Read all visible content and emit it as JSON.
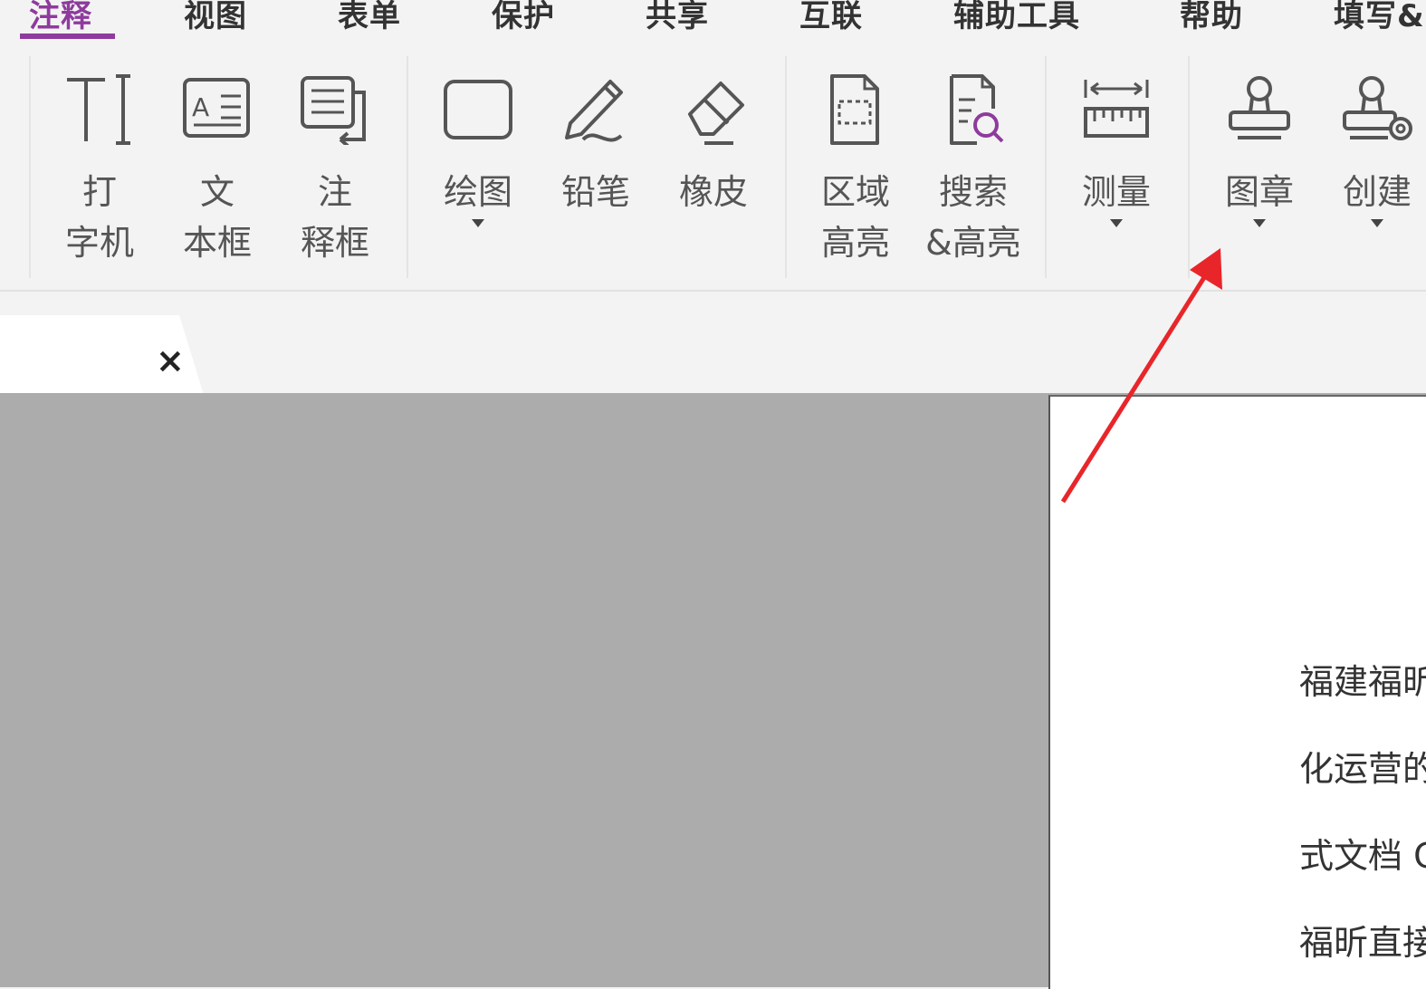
{
  "menu": {
    "items": [
      {
        "label": "注释",
        "active": true
      },
      {
        "label": "视图"
      },
      {
        "label": "表单"
      },
      {
        "label": "保护"
      },
      {
        "label": "共享"
      },
      {
        "label": "互联"
      },
      {
        "label": "辅助工具"
      },
      {
        "label": "帮助"
      },
      {
        "label": "填写&"
      }
    ]
  },
  "ribbon": {
    "typewriter": "打\n字机",
    "textbox": "文\n本框",
    "callout": "注\n释框",
    "drawing": "绘图",
    "pencil": "铅笔",
    "eraser": "橡皮",
    "area_highlight": "区域\n高亮",
    "search_highlight": "搜索\n&高亮",
    "measure": "测量",
    "stamp": "图章",
    "create": "创建"
  },
  "tab": {
    "close_label": "×"
  },
  "document": {
    "lines": [
      "福建福昕",
      "化运营的",
      "式文档 C",
      "福昕直接"
    ]
  },
  "colors": {
    "accent": "#8e3b9d",
    "arrow": "#e8262a",
    "canvas": "#acacac"
  }
}
